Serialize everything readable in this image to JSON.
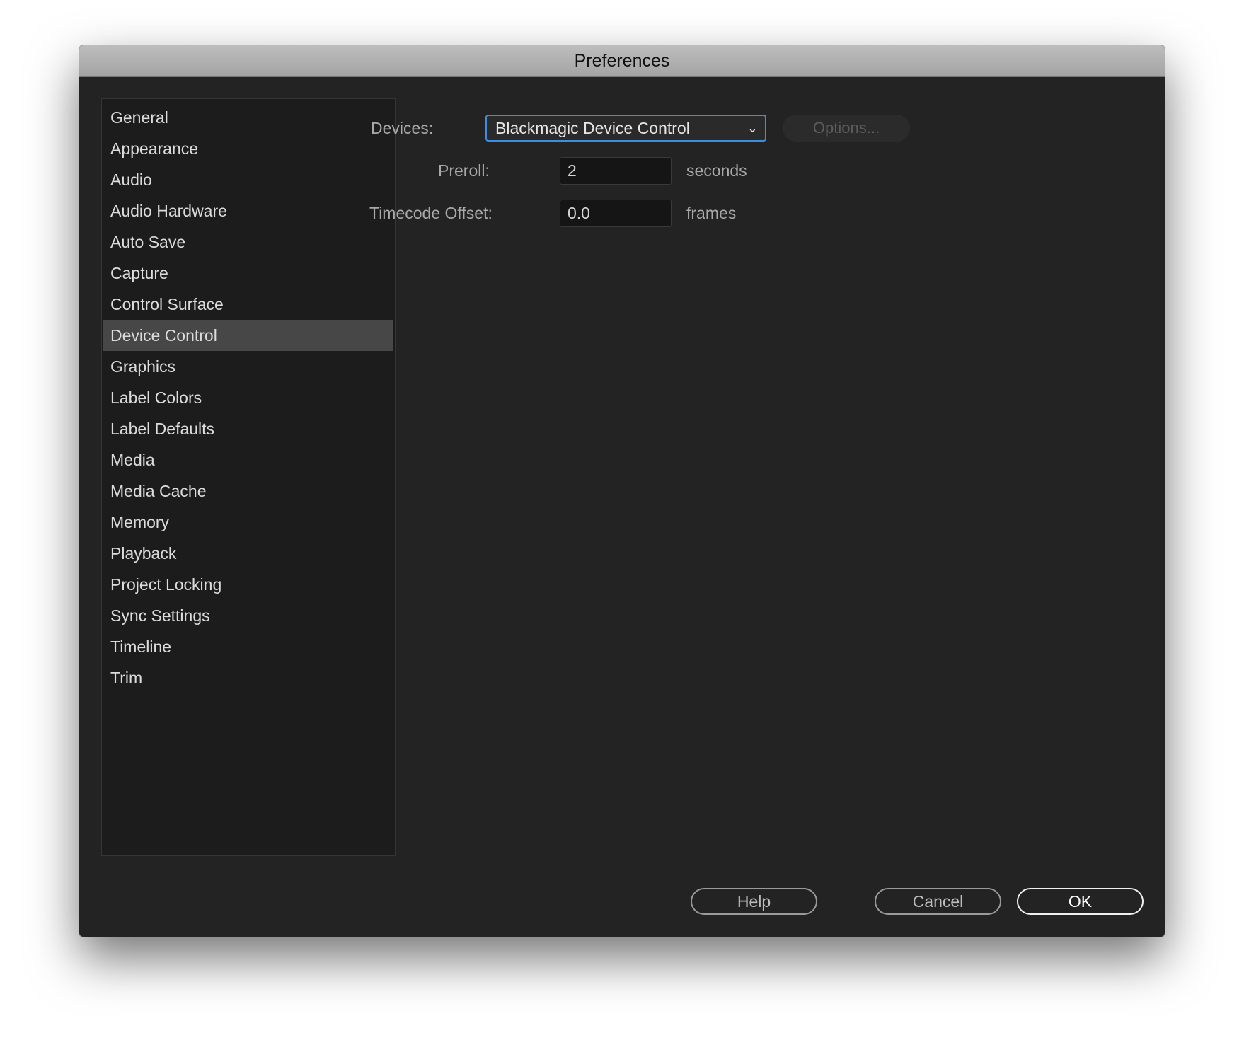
{
  "window": {
    "title": "Preferences"
  },
  "sidebar": {
    "items": [
      {
        "label": "General"
      },
      {
        "label": "Appearance"
      },
      {
        "label": "Audio"
      },
      {
        "label": "Audio Hardware"
      },
      {
        "label": "Auto Save"
      },
      {
        "label": "Capture"
      },
      {
        "label": "Control Surface"
      },
      {
        "label": "Device Control",
        "selected": true
      },
      {
        "label": "Graphics"
      },
      {
        "label": "Label Colors"
      },
      {
        "label": "Label Defaults"
      },
      {
        "label": "Media"
      },
      {
        "label": "Media Cache"
      },
      {
        "label": "Memory"
      },
      {
        "label": "Playback"
      },
      {
        "label": "Project Locking"
      },
      {
        "label": "Sync Settings"
      },
      {
        "label": "Timeline"
      },
      {
        "label": "Trim"
      }
    ]
  },
  "device_control": {
    "devices_label": "Devices:",
    "devices_value": "Blackmagic Device Control",
    "options_label": "Options...",
    "preroll_label": "Preroll:",
    "preroll_value": "2",
    "preroll_unit": "seconds",
    "timecode_label": "Timecode Offset:",
    "timecode_value": "0.0",
    "timecode_unit": "frames"
  },
  "buttons": {
    "help": "Help",
    "cancel": "Cancel",
    "ok": "OK"
  },
  "colors": {
    "accent": "#3d8ee0",
    "selected_row": "#474747"
  }
}
